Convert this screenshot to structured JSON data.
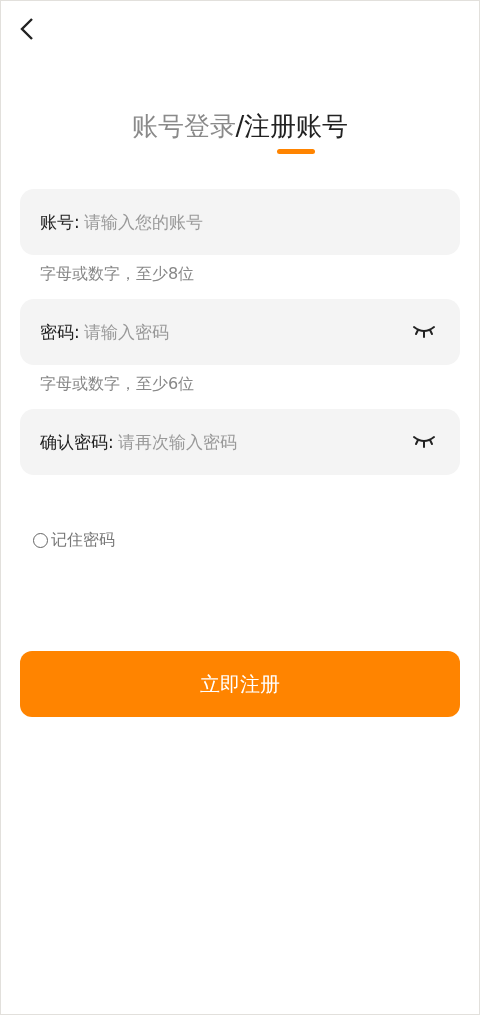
{
  "tabs": [
    {
      "label": "账号登录",
      "selected": false
    },
    {
      "label": "注册账号",
      "selected": true
    }
  ],
  "tab_separator": "/",
  "fields": [
    {
      "label": "账号:",
      "placeholder": "请输入您的账号",
      "hint": "字母或数字，至少8位",
      "password": false
    },
    {
      "label": "密码:",
      "placeholder": "请输入密码",
      "hint": "字母或数字，至少6位",
      "password": true
    },
    {
      "label": "确认密码:",
      "placeholder": "请再次输入密码",
      "password": true
    }
  ],
  "remember": {
    "label": "记住密码",
    "checked": false
  },
  "submit": "立即注册"
}
